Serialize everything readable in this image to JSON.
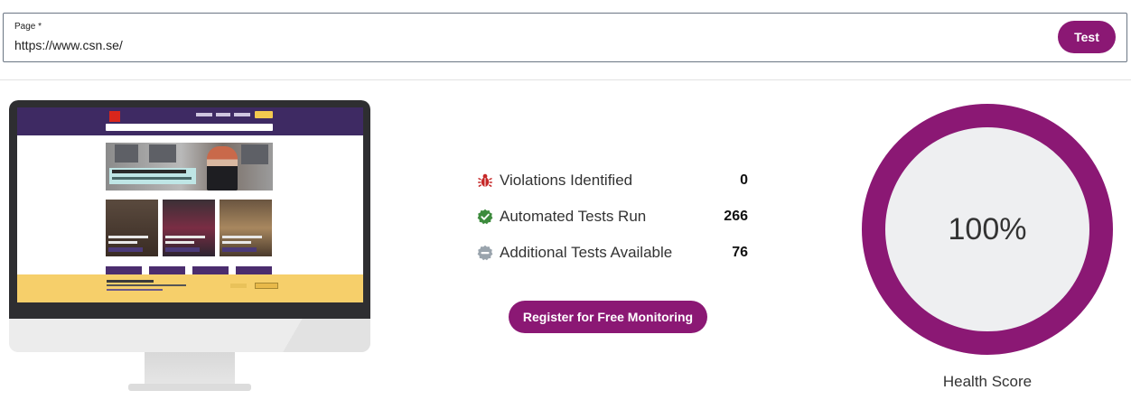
{
  "url_form": {
    "label": "Page *",
    "value": "https://www.csn.se/",
    "test_button": "Test"
  },
  "stats": [
    {
      "icon": "bug-icon",
      "label": "Violations Identified",
      "value": "0",
      "color": "#c62828"
    },
    {
      "icon": "check-badge-icon",
      "label": "Automated Tests Run",
      "value": "266",
      "color": "#3d8b3d"
    },
    {
      "icon": "minus-badge-icon",
      "label": "Additional Tests Available",
      "value": "76",
      "color": "#9aa4ad"
    }
  ],
  "register_button": "Register for Free Monitoring",
  "health": {
    "score_text": "100%",
    "score_fraction": 1.0,
    "caption": "Health Score",
    "ring_color": "#8b1874",
    "inner_color": "#eeeff1"
  },
  "colors": {
    "accent": "#8b1874",
    "screen_header": "#3e2a63",
    "cookie_banner": "#f6cf6a"
  }
}
